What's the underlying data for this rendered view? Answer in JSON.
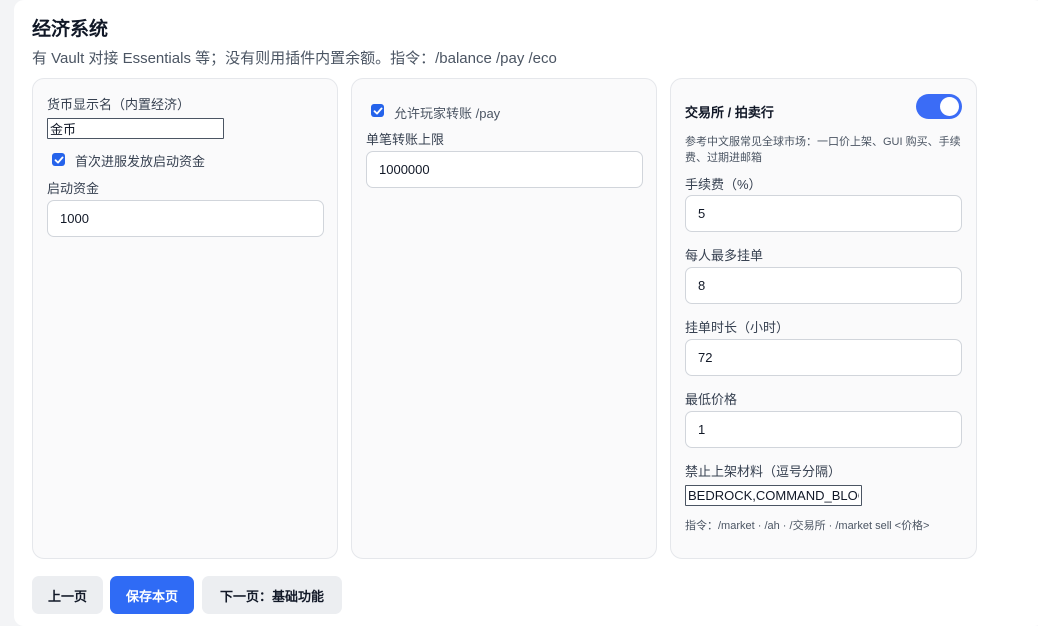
{
  "header": {
    "title": "经济系统",
    "subtitle": "有 Vault 对接 Essentials 等；没有则用插件内置余额。指令：/balance /pay /eco"
  },
  "card_currency": {
    "currency_name_label": "货币显示名（内置经济）",
    "currency_name_value": "金币",
    "starting_funds_checkbox_label": "首次进服发放启动资金",
    "starting_funds_checked": true,
    "starting_funds_label": "启动资金",
    "starting_funds_value": "1000"
  },
  "card_transfer": {
    "allow_pay_checkbox_label": "允许玩家转账 /pay",
    "allow_pay_checked": true,
    "max_transfer_label": "单笔转账上限",
    "max_transfer_value": "1000000"
  },
  "card_market": {
    "heading": "交易所 / 拍卖行",
    "enabled": true,
    "note": "参考中文服常见全球市场：一口价上架、GUI 购买、手续费、过期进邮箱",
    "fee_label": "手续费（%）",
    "fee_value": "5",
    "max_listings_label": "每人最多挂单",
    "max_listings_value": "8",
    "listing_duration_label": "挂单时长（小时）",
    "listing_duration_value": "72",
    "min_price_label": "最低价格",
    "min_price_value": "1",
    "banned_materials_label": "禁止上架材料（逗号分隔）",
    "banned_materials_value": "BEDROCK,COMMAND_BLOCK",
    "commands_note": "指令：/market · /ah · /交易所 · /market sell <价格>"
  },
  "footer": {
    "prev_label": "上一页",
    "save_label": "保存本页",
    "next_label": "下一页：基础功能"
  },
  "colors": {
    "accent": "#2f6bf5",
    "toggle_on": "#3b6cf6"
  }
}
